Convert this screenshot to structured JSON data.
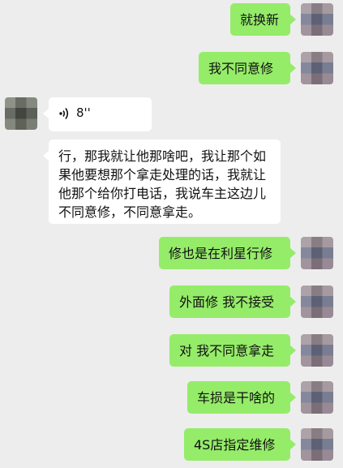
{
  "messages": [
    {
      "side": "out",
      "text": "就换新"
    },
    {
      "side": "out",
      "text": "我不同意修"
    },
    {
      "side": "in",
      "type": "voice",
      "duration": "8''"
    },
    {
      "side": "in",
      "text": "行，那我就让他那啥吧，我让那个如果他要想那个拿走处理的话，我就让他那个给你打电话，我说车主这边儿不同意修，不同意拿走。"
    },
    {
      "side": "out",
      "text": "修也是在利星行修"
    },
    {
      "side": "out",
      "text": "外面修 我不接受"
    },
    {
      "side": "out",
      "text": "对 我不同意拿走"
    },
    {
      "side": "out",
      "text": "车损是干啥的"
    },
    {
      "side": "out",
      "text": "4S店指定维修"
    }
  ],
  "icons": {
    "voice": "voice-wave-icon"
  },
  "colors": {
    "background": "#ededed",
    "outgoing_bubble": "#95ec69",
    "incoming_bubble": "#ffffff"
  }
}
